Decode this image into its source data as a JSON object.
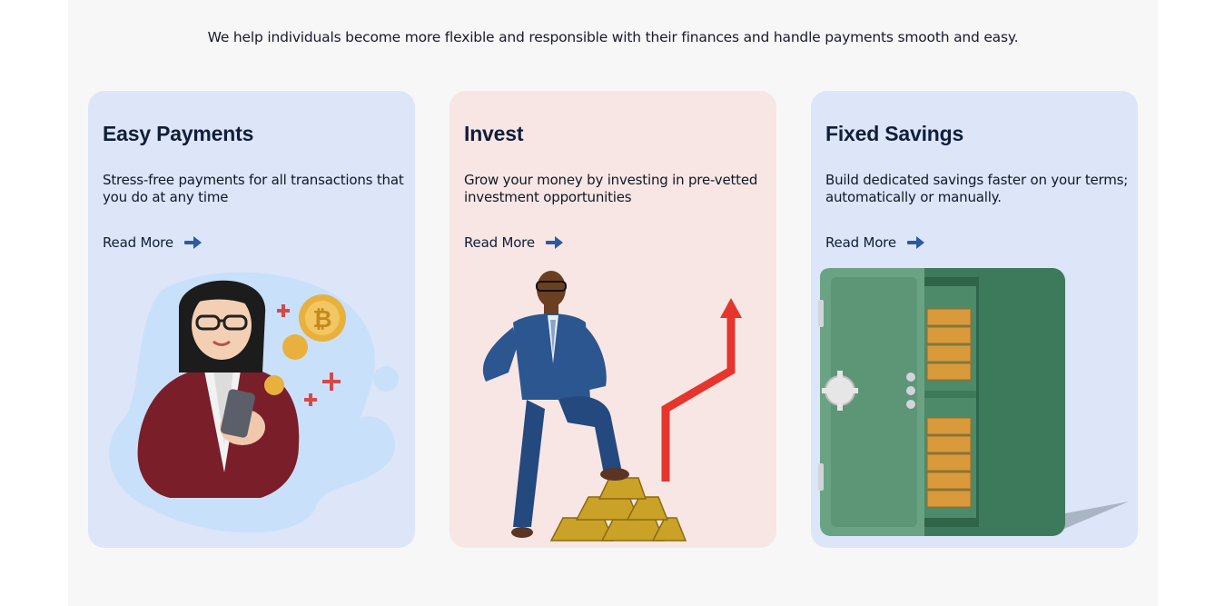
{
  "intro": "We help individuals become more flexible and responsible with their finances and handle payments smooth and easy.",
  "cards": [
    {
      "title": "Easy Payments",
      "description": "Stress-free payments for all transactions that you do at any time",
      "link": "Read More",
      "icon": "arrow-right-icon",
      "illustration": "woman-with-phone-and-coins",
      "background": "#dce6f8"
    },
    {
      "title": "Invest",
      "description": "Grow your money by investing in pre-vetted investment opportunities",
      "link": "Read More",
      "icon": "arrow-right-icon",
      "illustration": "man-on-gold-bars-with-growth-arrow",
      "background": "#f8e6e4"
    },
    {
      "title": "Fixed Savings",
      "description": "Build dedicated savings faster on your terms; automatically or manually.",
      "link": "Read More",
      "icon": "arrow-right-icon",
      "illustration": "open-safe-with-gold-bars",
      "background": "#dce6f8"
    }
  ],
  "colors": {
    "accent": "#2c5aa0",
    "heading": "#0f1e3a",
    "section_bg": "#f7f7f7"
  }
}
